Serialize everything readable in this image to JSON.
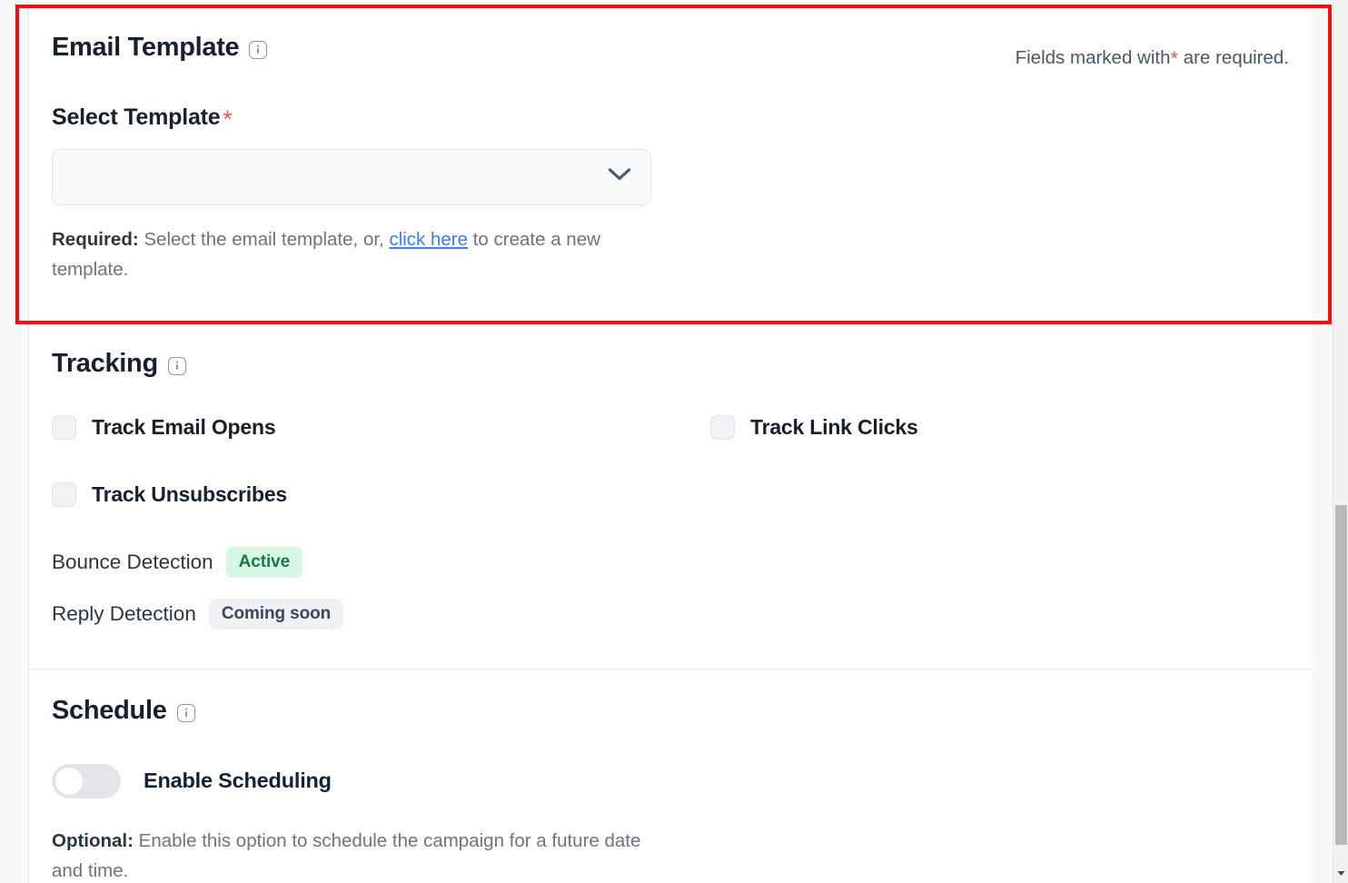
{
  "email_template": {
    "title": "Email Template",
    "info_icon": "info-icon",
    "required_note_prefix": "Fields marked with",
    "required_note_star": "*",
    "required_note_suffix": "are required.",
    "field_label": "Select Template",
    "field_required_star": "*",
    "select": {
      "value": "",
      "placeholder": "",
      "chevron_icon": "chevron-down-icon"
    },
    "help": {
      "strong": "Required:",
      "text_before_link": " Select the email template, or, ",
      "link_text": "click here",
      "text_after_link": " to create a new template."
    }
  },
  "tracking": {
    "title": "Tracking",
    "info_icon": "info-icon",
    "checkboxes": [
      {
        "label": "Track Email Opens",
        "checked": false
      },
      {
        "label": "Track Link Clicks",
        "checked": false
      },
      {
        "label": "Track Unsubscribes",
        "checked": false
      }
    ],
    "detections": [
      {
        "label": "Bounce Detection",
        "badge": "Active",
        "badge_style": "active"
      },
      {
        "label": "Reply Detection",
        "badge": "Coming soon",
        "badge_style": "soon"
      }
    ]
  },
  "schedule": {
    "title": "Schedule",
    "info_icon": "info-icon",
    "toggle": {
      "label": "Enable Scheduling",
      "enabled": false
    },
    "help": {
      "strong": "Optional:",
      "text": " Enable this option to schedule the campaign for a future date and time."
    }
  },
  "colors": {
    "required_star": "#e8544a",
    "link": "#3d7cf4",
    "badge_active_bg": "#d9f5e3",
    "badge_active_text": "#16794a",
    "badge_soon_bg": "#f0f1f4",
    "highlight_border": "#fb0a0a",
    "page_background": "#f6f8fa",
    "card_background": "#ffffff"
  },
  "scrollbar": {
    "arrow_icon": "caret-down-icon"
  }
}
